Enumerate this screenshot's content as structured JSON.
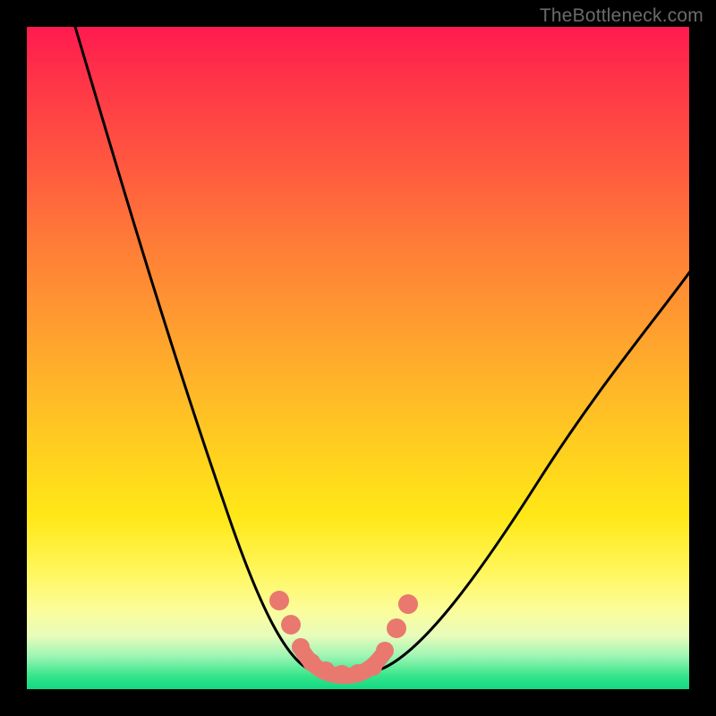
{
  "watermark": "TheBottleneck.com",
  "chart_data": {
    "type": "line",
    "title": "",
    "xlabel": "",
    "ylabel": "",
    "xlim": [
      0,
      100
    ],
    "ylim": [
      0,
      100
    ],
    "series": [
      {
        "name": "gradient-background",
        "description": "Vertical red→yellow→green gradient indicating bottleneck severity (red high, green low)"
      },
      {
        "name": "bottleneck-curve",
        "description": "Black V-shaped curve; minimum near x≈46 at y≈2",
        "x": [
          7,
          10,
          15,
          20,
          25,
          30,
          35,
          38,
          40,
          42,
          44,
          46,
          48,
          50,
          52,
          55,
          60,
          65,
          70,
          75,
          80,
          85,
          90,
          95,
          100
        ],
        "values": [
          100,
          91,
          78,
          66,
          54,
          42,
          30,
          22,
          15,
          9,
          4,
          2,
          2,
          3,
          5,
          8,
          14,
          20,
          27,
          33,
          40,
          46,
          52,
          58,
          64
        ]
      },
      {
        "name": "marker-dots",
        "description": "Salmon marker dots near curve minimum",
        "x": [
          38.5,
          40.5,
          42,
          44,
          46,
          48,
          50,
          51.5,
          53.5,
          55.5
        ],
        "values": [
          13,
          9,
          5,
          3,
          2.5,
          2.5,
          3,
          5,
          9,
          13
        ]
      }
    ],
    "colors": {
      "curve": "#000000",
      "markers": "#e9796e",
      "gradient_top": "#ff1a4f",
      "gradient_mid": "#ffe817",
      "gradient_bottom": "#12d884"
    }
  }
}
